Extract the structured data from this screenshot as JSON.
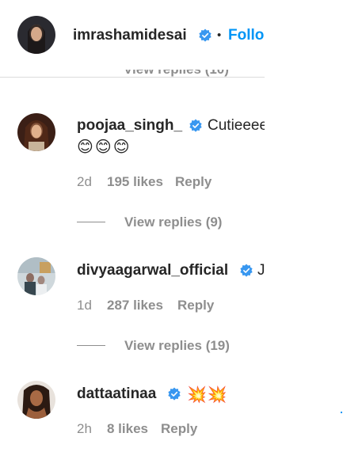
{
  "header": {
    "username": "imrashamidesai",
    "separator": "•",
    "follow_label": "Follo",
    "partial_view_replies": "View replies (10)"
  },
  "comments": [
    {
      "username": "poojaa_singh_",
      "text": "Cutieeee",
      "emojis": "😊😊😊",
      "age": "2d",
      "likes": "195 likes",
      "reply": "Reply",
      "view_replies": "View replies (9)"
    },
    {
      "username": "divyaagarwal_official",
      "text": "J",
      "age": "1d",
      "likes": "287 likes",
      "reply": "Reply",
      "view_replies": "View replies (19)"
    },
    {
      "username": "dattaatinaa",
      "emojis": "💥💥",
      "age": "2h",
      "likes": "8 likes",
      "reply": "Reply"
    }
  ],
  "colors": {
    "text": "#262626",
    "muted": "#8e8e8e",
    "link": "#0095f6",
    "verified": "#3897f0"
  }
}
